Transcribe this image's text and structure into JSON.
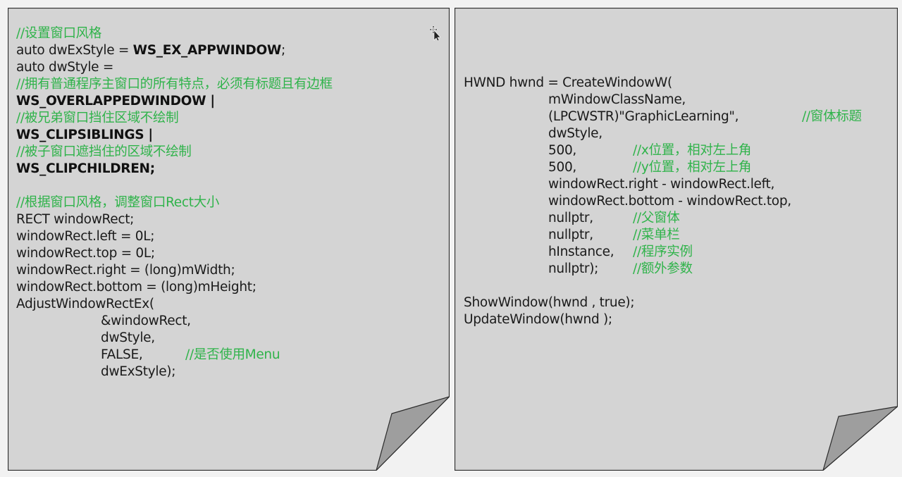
{
  "colors": {
    "background": "#f2f2f2",
    "page_fill": "#d4d4d4",
    "page_border": "#2b2b2b",
    "curl_fill": "#9e9e9e",
    "code_text": "#1a1a1a",
    "comment": "#2fb34a"
  },
  "left_panel": {
    "lines": [
      [
        {
          "t": "//设置窗口风格",
          "s": "c"
        }
      ],
      [
        {
          "t": "auto dwExStyle = ",
          "s": ""
        },
        {
          "t": "WS_EX_APPWINDOW",
          "s": "b"
        },
        {
          "t": ";",
          "s": ""
        }
      ],
      [
        {
          "t": "auto dwStyle =",
          "s": ""
        }
      ],
      [
        {
          "t": "//拥有普通程序主窗口的所有特点，必须有标题且有边框",
          "s": "c"
        }
      ],
      [
        {
          "t": "WS_OVERLAPPEDWINDOW |",
          "s": "b"
        }
      ],
      [
        {
          "t": "//被兄弟窗口挡住区域不绘制",
          "s": "c"
        }
      ],
      [
        {
          "t": "WS_CLIPSIBLINGS |",
          "s": "b"
        }
      ],
      [
        {
          "t": "//被子窗口遮挡住的区域不绘制",
          "s": "c"
        }
      ],
      [
        {
          "t": "WS_CLIPCHILDREN;",
          "s": "b"
        }
      ],
      [],
      [
        {
          "t": "//根据窗口风格，调整窗口Rect大小",
          "s": "c"
        }
      ],
      [
        {
          "t": "RECT windowRect;",
          "s": ""
        }
      ],
      [
        {
          "t": "windowRect.left = 0L;",
          "s": ""
        }
      ],
      [
        {
          "t": "windowRect.top = 0L;",
          "s": ""
        }
      ],
      [
        {
          "t": "windowRect.right = (long)mWidth;",
          "s": ""
        }
      ],
      [
        {
          "t": "windowRect.bottom = (long)mHeight;",
          "s": ""
        }
      ],
      [
        {
          "t": "AdjustWindowRectEx(",
          "s": ""
        }
      ],
      [
        {
          "t": "&windowRect,",
          "s": "",
          "i": 1
        }
      ],
      [
        {
          "t": "dwStyle,",
          "s": "",
          "i": 1
        }
      ],
      [
        {
          "t": "FALSE,",
          "s": "",
          "i": 1
        },
        {
          "t": "//是否使用Menu",
          "s": "c",
          "col": 2
        }
      ],
      [
        {
          "t": "dwExStyle);",
          "s": "",
          "i": 1
        }
      ]
    ]
  },
  "right_panel": {
    "lines": [
      [
        {
          "t": "HWND hwnd = CreateWindowW(",
          "s": ""
        }
      ],
      [
        {
          "t": "mWindowClassName,",
          "s": "",
          "i": 1
        }
      ],
      [
        {
          "t": "(LPCWSTR)\"GraphicLearning\",",
          "s": "",
          "i": 1
        },
        {
          "t": "//窗体标题",
          "s": "c",
          "col": 3
        }
      ],
      [
        {
          "t": "dwStyle,",
          "s": "",
          "i": 1
        }
      ],
      [
        {
          "t": "500,",
          "s": "",
          "i": 1
        },
        {
          "t": "//x位置，相对左上角",
          "s": "c",
          "col": 2
        }
      ],
      [
        {
          "t": "500,",
          "s": "",
          "i": 1
        },
        {
          "t": "//y位置，相对左上角",
          "s": "c",
          "col": 2
        }
      ],
      [
        {
          "t": "windowRect.right - windowRect.left,",
          "s": "",
          "i": 1
        }
      ],
      [
        {
          "t": "windowRect.bottom - windowRect.top,",
          "s": "",
          "i": 1
        }
      ],
      [
        {
          "t": "nullptr,",
          "s": "",
          "i": 1
        },
        {
          "t": "//父窗体",
          "s": "c",
          "col": 2
        }
      ],
      [
        {
          "t": "nullptr,",
          "s": "",
          "i": 1
        },
        {
          "t": "//菜单栏",
          "s": "c",
          "col": 2
        }
      ],
      [
        {
          "t": "hInstance,",
          "s": "",
          "i": 1
        },
        {
          "t": "//程序实例",
          "s": "c",
          "col": 2
        }
      ],
      [
        {
          "t": "nullptr);",
          "s": "",
          "i": 1
        },
        {
          "t": "//额外参数",
          "s": "c",
          "col": 2
        }
      ],
      [],
      [
        {
          "t": "ShowWindow(hwnd , true);",
          "s": ""
        }
      ],
      [
        {
          "t": "UpdateWindow(hwnd );",
          "s": ""
        }
      ]
    ]
  },
  "cursor_icon": "move-cursor-icon"
}
